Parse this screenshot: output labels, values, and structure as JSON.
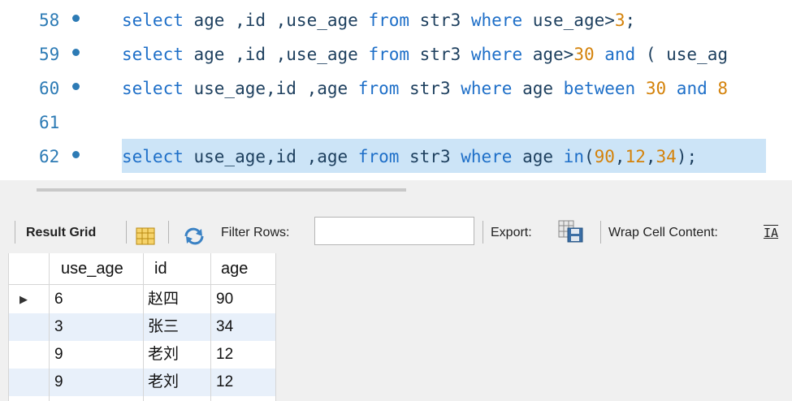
{
  "editor": {
    "lines": [
      {
        "number": "58",
        "dot": true,
        "tokens": [
          {
            "t": "select",
            "c": "kw"
          },
          {
            "t": " age ,id ,use_age ",
            "c": "txt"
          },
          {
            "t": "from",
            "c": "kw"
          },
          {
            "t": " str3 ",
            "c": "txt"
          },
          {
            "t": "where",
            "c": "kw"
          },
          {
            "t": " use_age>",
            "c": "txt"
          },
          {
            "t": "3",
            "c": "num"
          },
          {
            "t": ";",
            "c": "txt"
          }
        ]
      },
      {
        "number": "59",
        "dot": true,
        "tokens": [
          {
            "t": "select",
            "c": "kw"
          },
          {
            "t": " age ,id ,use_age ",
            "c": "txt"
          },
          {
            "t": "from",
            "c": "kw"
          },
          {
            "t": " str3 ",
            "c": "txt"
          },
          {
            "t": "where",
            "c": "kw"
          },
          {
            "t": " age>",
            "c": "txt"
          },
          {
            "t": "30",
            "c": "num"
          },
          {
            "t": " ",
            "c": "txt"
          },
          {
            "t": "and",
            "c": "kw"
          },
          {
            "t": " ( use_ag",
            "c": "txt"
          }
        ]
      },
      {
        "number": "60",
        "dot": true,
        "tokens": [
          {
            "t": "select",
            "c": "kw"
          },
          {
            "t": " use_age,id ,age ",
            "c": "txt"
          },
          {
            "t": "from",
            "c": "kw"
          },
          {
            "t": " str3 ",
            "c": "txt"
          },
          {
            "t": "where",
            "c": "kw"
          },
          {
            "t": " age ",
            "c": "txt"
          },
          {
            "t": "between",
            "c": "kw"
          },
          {
            "t": " ",
            "c": "txt"
          },
          {
            "t": "30",
            "c": "num"
          },
          {
            "t": " ",
            "c": "txt"
          },
          {
            "t": "and",
            "c": "kw"
          },
          {
            "t": " ",
            "c": "txt"
          },
          {
            "t": "8",
            "c": "num"
          }
        ]
      },
      {
        "number": "61",
        "dot": false,
        "tokens": []
      },
      {
        "number": "62",
        "dot": true,
        "tokens": [
          {
            "t": "select",
            "c": "kw"
          },
          {
            "t": " use_age,id ,age ",
            "c": "txt"
          },
          {
            "t": "from",
            "c": "kw"
          },
          {
            "t": " str3 ",
            "c": "txt"
          },
          {
            "t": "where",
            "c": "kw"
          },
          {
            "t": " age ",
            "c": "txt"
          },
          {
            "t": "in",
            "c": "kw"
          },
          {
            "t": "(",
            "c": "txt"
          },
          {
            "t": "90",
            "c": "num"
          },
          {
            "t": ",",
            "c": "txt"
          },
          {
            "t": "12",
            "c": "num"
          },
          {
            "t": ",",
            "c": "txt"
          },
          {
            "t": "34",
            "c": "num"
          },
          {
            "t": ");",
            "c": "txt"
          }
        ]
      }
    ]
  },
  "toolbar": {
    "result_grid_label": "Result Grid",
    "filter_rows_label": "Filter Rows:",
    "filter_value": "",
    "export_label": "Export:",
    "wrap_label": "Wrap Cell Content:",
    "wrap_icon_glyph": "IA"
  },
  "grid": {
    "columns": [
      "use_age",
      "id",
      "age"
    ],
    "rows": [
      [
        "6",
        "赵四",
        "90"
      ],
      [
        "3",
        "张三",
        "34"
      ],
      [
        "9",
        "老刘",
        "12"
      ],
      [
        "9",
        "老刘",
        "12"
      ]
    ],
    "current_row_marker": "▶"
  },
  "colors": {
    "keyword": "#1e6fc8",
    "number": "#d4820a",
    "text": "#1d3f5e",
    "line_number": "#2d7bb5",
    "selection": "#cce4f7",
    "alt_row": "#e8f0fa"
  }
}
